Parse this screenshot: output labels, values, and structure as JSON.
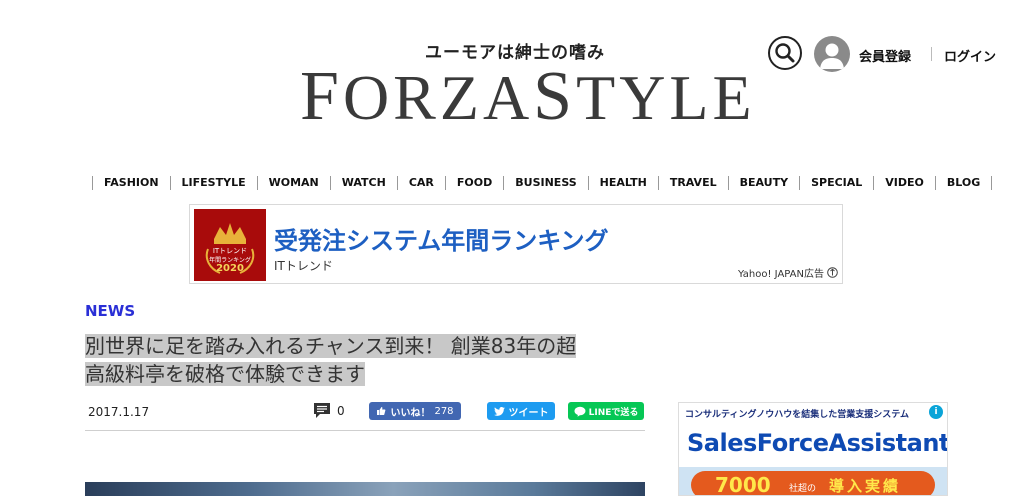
{
  "header": {
    "tagline": "ユーモアは紳士の嗜み",
    "logo_part1": "F",
    "logo_part2": "ORZA",
    "logo_part3": "S",
    "logo_part4": "TYLE",
    "register_label": "会員登録",
    "login_label": "ログイン"
  },
  "nav": {
    "items": [
      "FASHION",
      "LIFESTYLE",
      "WOMAN",
      "WATCH",
      "CAR",
      "FOOD",
      "BUSINESS",
      "HEALTH",
      "TRAVEL",
      "BEAUTY",
      "SPECIAL",
      "VIDEO",
      "BLOG"
    ]
  },
  "ad": {
    "badge_line1": "ITトレンド",
    "badge_line2": "年間ランキング",
    "badge_year": "2020",
    "title": "受発注システム年間ランキング",
    "subtitle": "ITトレンド",
    "credit": "Yahoo! JAPAN広告"
  },
  "article": {
    "category": "NEWS",
    "title_line1": "別世界に足を踏み入れるチャンス到来！ 創業83年の超",
    "title_line2": "高級料亭を破格で体験できます",
    "date": "2017.1.17",
    "comment_count": "0",
    "fb_label": "いいね！",
    "fb_count": "278",
    "tweet_label": "ツイート",
    "line_label": "LINEで送る"
  },
  "side_ad": {
    "top_text": "コンサルティングノウハウを結集した営業支援システム",
    "brand": "SalesForceAssistant",
    "count": "7000",
    "count_unit": "社超の",
    "count_label": "導入実績"
  },
  "colors": {
    "category": "#2a2fd6",
    "ad_title": "#1d5fc2",
    "facebook": "#4267b2",
    "twitter": "#1d9bf0",
    "line": "#06c755"
  }
}
